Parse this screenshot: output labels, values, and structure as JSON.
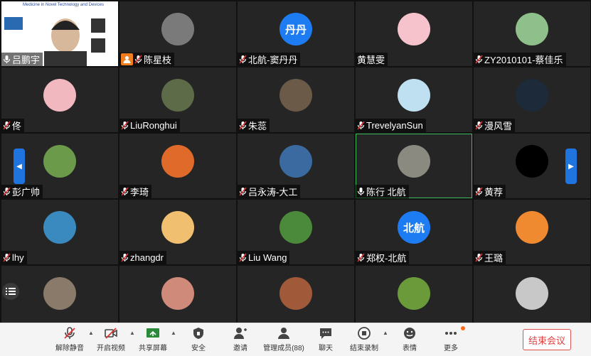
{
  "participants": [
    {
      "name": "吕鹏宇",
      "mic": "on",
      "avatar": "video"
    },
    {
      "name": "陈星枝",
      "mic": "muted",
      "avatar": "photo",
      "host": true,
      "color": "#7a7a7a"
    },
    {
      "name": "北航-窦丹丹",
      "mic": "muted",
      "avatar": "text",
      "text": "丹丹",
      "color": "#1e7cf2"
    },
    {
      "name": "黄慧雯",
      "mic": "none",
      "avatar": "photo",
      "color": "#f6c2cc"
    },
    {
      "name": "ZY2010101-蔡佳乐",
      "mic": "muted",
      "avatar": "photo",
      "color": "#8fbf8a"
    },
    {
      "name": "佟",
      "mic": "muted",
      "avatar": "photo",
      "color": "#f2b8c0"
    },
    {
      "name": "LiuRonghui",
      "mic": "muted",
      "avatar": "photo",
      "color": "#5d6b48"
    },
    {
      "name": "朱蕊",
      "mic": "muted",
      "avatar": "photo",
      "color": "#6b5a48"
    },
    {
      "name": "TrevelyanSun",
      "mic": "muted",
      "avatar": "photo",
      "color": "#bfe0f0"
    },
    {
      "name": "漫风雪",
      "mic": "muted",
      "avatar": "photo",
      "color": "#1c2a3a"
    },
    {
      "name": "彭广帅",
      "mic": "muted",
      "avatar": "photo",
      "color": "#6a9a4a"
    },
    {
      "name": "李琦",
      "mic": "muted",
      "avatar": "photo",
      "color": "#e06a2a"
    },
    {
      "name": "吕永涛-大工",
      "mic": "muted",
      "avatar": "photo",
      "color": "#3a6aa0"
    },
    {
      "name": "陈行 北航",
      "mic": "on",
      "avatar": "photo",
      "color": "#8a8a80",
      "active": true
    },
    {
      "name": "黄荐",
      "mic": "muted",
      "avatar": "photo",
      "color": "#000000"
    },
    {
      "name": "lhy",
      "mic": "muted",
      "avatar": "photo",
      "color": "#3a8ac0"
    },
    {
      "name": "zhangdr",
      "mic": "muted",
      "avatar": "photo",
      "color": "#f0c070"
    },
    {
      "name": "Liu Wang",
      "mic": "muted",
      "avatar": "photo",
      "color": "#4a8a3a"
    },
    {
      "name": "郑权-北航",
      "mic": "muted",
      "avatar": "text",
      "text": "北航",
      "color": "#1e7cf2"
    },
    {
      "name": "王璐",
      "mic": "muted",
      "avatar": "photo",
      "color": "#f08a30"
    },
    {
      "name": "",
      "mic": "none",
      "avatar": "photo",
      "color": "#8a7a6a"
    },
    {
      "name": "",
      "mic": "none",
      "avatar": "photo",
      "color": "#d08a7a"
    },
    {
      "name": "",
      "mic": "none",
      "avatar": "photo",
      "color": "#a05a3a"
    },
    {
      "name": "",
      "mic": "none",
      "avatar": "photo",
      "color": "#6a9a3a"
    },
    {
      "name": "",
      "mic": "none",
      "avatar": "photo",
      "color": "#c8c8c8"
    }
  ],
  "share_title": "Medicine in Novel Technology and Devices",
  "toolbar": {
    "unmute": "解除静音",
    "video": "开启视频",
    "share": "共享屏幕",
    "security": "安全",
    "invite": "邀请",
    "members": "管理成员(88)",
    "chat": "聊天",
    "record": "结束录制",
    "reactions": "表情",
    "more": "更多",
    "end": "结束会议"
  },
  "colors": {
    "accent": "#1f74e0",
    "end": "#e04040",
    "host": "#f07d1e"
  }
}
